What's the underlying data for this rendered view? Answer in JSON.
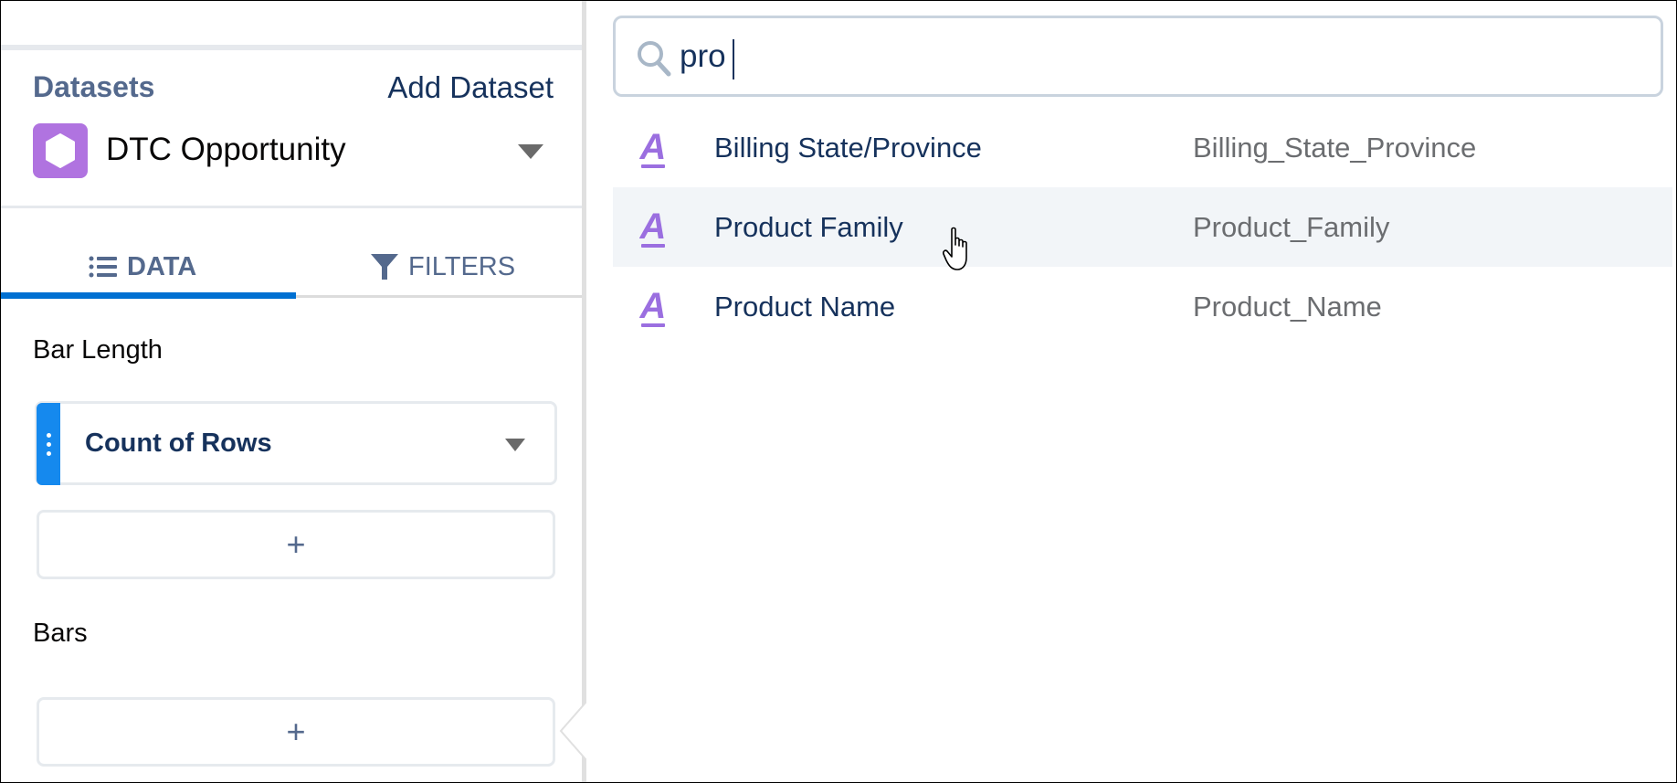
{
  "left_panel": {
    "datasets_title": "Datasets",
    "add_dataset_label": "Add Dataset",
    "dataset": {
      "name": "DTC Opportunity",
      "icon": "dataset-hexagon-icon",
      "icon_color": "#b073e0"
    },
    "tabs": [
      {
        "label": "DATA",
        "icon": "list-icon",
        "active": true
      },
      {
        "label": "FILTERS",
        "icon": "filter-funnel-icon",
        "active": false
      }
    ],
    "sections": {
      "bar_length": {
        "label": "Bar Length",
        "field": "Count of Rows",
        "add_label": "+"
      },
      "bars": {
        "label": "Bars",
        "add_label": "+"
      }
    },
    "accent_color": "#0070d2",
    "handle_color": "#1589ee"
  },
  "search": {
    "value": "pro",
    "icon": "search-icon"
  },
  "results": [
    {
      "label": "Billing State/Province",
      "api_name": "Billing_State_Province",
      "type_icon": "text-dimension-icon",
      "hovered": false
    },
    {
      "label": "Product Family",
      "api_name": "Product_Family",
      "type_icon": "text-dimension-icon",
      "hovered": true
    },
    {
      "label": "Product Name",
      "api_name": "Product_Name",
      "type_icon": "text-dimension-icon",
      "hovered": false
    }
  ],
  "colors": {
    "dimension_icon": "#9b6fe0",
    "hover_row": "#f2f5f8",
    "label_text": "#16325c",
    "api_text": "#6b6d70"
  }
}
